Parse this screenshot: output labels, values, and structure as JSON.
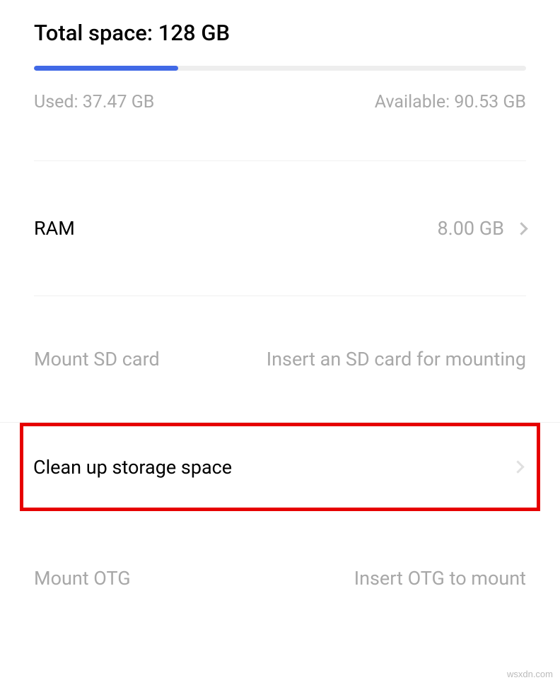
{
  "storage": {
    "total_label": "Total space: 128 GB",
    "used_label": "Used: 37.47 GB",
    "available_label": "Available: 90.53 GB",
    "progress_percent": 29.3
  },
  "ram": {
    "label": "RAM",
    "value": "8.00 GB"
  },
  "sd_card": {
    "label": "Mount SD card",
    "desc": "Insert an SD card for mounting"
  },
  "cleanup": {
    "label": "Clean up storage space"
  },
  "otg": {
    "label": "Mount OTG",
    "desc": "Insert OTG to mount"
  },
  "watermark": "wsxdn.com"
}
